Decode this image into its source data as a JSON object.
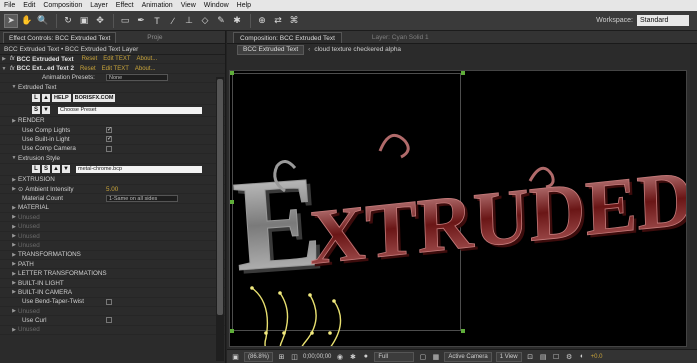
{
  "menu": [
    "File",
    "Edit",
    "Composition",
    "Layer",
    "Effect",
    "Animation",
    "View",
    "Window",
    "Help"
  ],
  "workspace": {
    "label": "Workspace:",
    "value": "Standard"
  },
  "left_panel": {
    "tab_active": "Effect Controls: BCC Extruded Text",
    "tab_other": "Proje",
    "breadcrumb": "BCC Extruded Text • BCC Extruded Text Layer",
    "effects": [
      {
        "name": "BCC Extruded Text",
        "reset": "Reset",
        "edit": "Edit TEXT",
        "about": "About..."
      },
      {
        "name": "BCC Ext...ed Text 2",
        "reset": "Reset",
        "edit": "Edit TEXT",
        "about": "About..."
      }
    ],
    "animation_presets_label": "Animation Presets:",
    "animation_presets_value": "None",
    "extruded_text_label": "Extruded Text",
    "help_label": "HELP",
    "borisfx_label": "BORISFX.COM",
    "choose_preset": "Choose Preset",
    "render_label": "RENDER",
    "use_comp_lights": "Use Comp Lights",
    "use_builtin_light": "Use Built-in Light",
    "use_comp_camera": "Use Comp Camera",
    "extrusion_style_label": "Extrusion Style",
    "extrusion_file": "metal-chrome.bcp",
    "extrusion_label": "EXTRUSION",
    "ambient_label": "Ambient Intensity",
    "ambient_value": "5.00",
    "material_count_label": "Material Count",
    "material_count_value": "1-Same on all sides",
    "material_label": "MATERIAL",
    "unused": "Unused",
    "transformations_label": "TRANSFORMATIONS",
    "path_label": "PATH",
    "letter_transformations_label": "LETTER TRANSFORMATIONS",
    "builtin_light_label": "BUILT-IN LIGHT",
    "builtin_camera_label": "BUILT-IN CAMERA",
    "use_bend_label": "Use Bend-Taper-Twist",
    "use_curl_label": "Use Curl"
  },
  "comp_panel": {
    "tab_active": "Composition: BCC Extruded Text",
    "tab_other": "Layer: Cyan Solid 1",
    "breadcrumb_comp": "BCC Extruded Text",
    "breadcrumb_layer": "cloud texture checkered alpha",
    "viewer_text": "EXTRUDED",
    "zoom": "(86.8%)",
    "timecode": "0;00;00;00",
    "resolution": "Full",
    "camera": "Active Camera",
    "view": "1 View",
    "exposure": "+0.0"
  },
  "colors": {
    "accent_link": "#c9a43a",
    "selection_handle": "#5fae3a",
    "extrusion_red": "#7a1e1e"
  }
}
